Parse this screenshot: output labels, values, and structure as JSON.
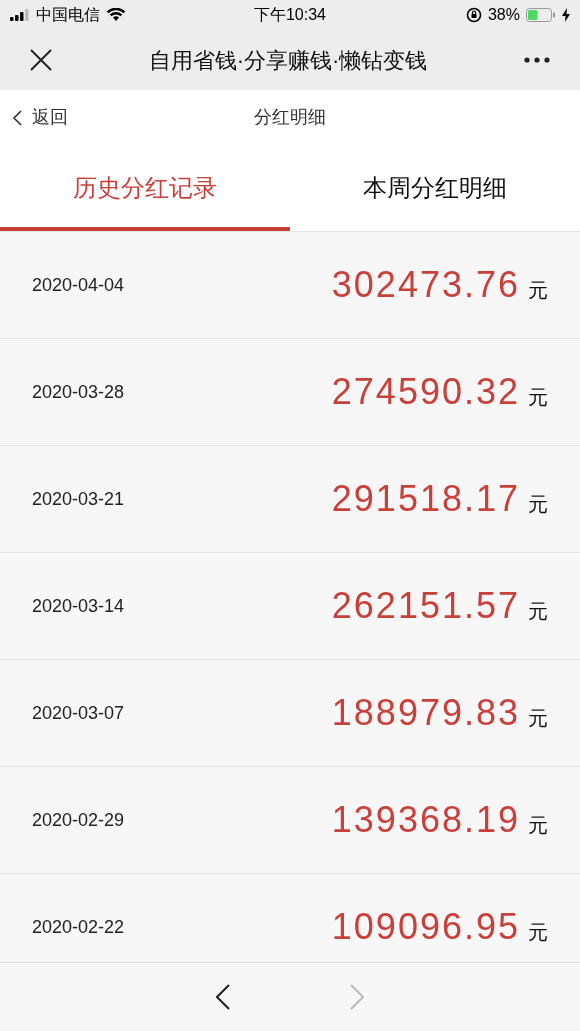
{
  "status_bar": {
    "carrier": "中国电信",
    "time": "下午10:34",
    "battery": "38%"
  },
  "window": {
    "title": "自用省钱·分享赚钱·懒钻变钱"
  },
  "header": {
    "back": "返回",
    "title": "分红明细"
  },
  "tabs": [
    {
      "label": "历史分红记录",
      "selected": true
    },
    {
      "label": "本周分红明细",
      "selected": false
    }
  ],
  "records": [
    {
      "date": "2020-04-04",
      "amount": "302473.76",
      "unit": "元"
    },
    {
      "date": "2020-03-28",
      "amount": "274590.32",
      "unit": "元"
    },
    {
      "date": "2020-03-21",
      "amount": "291518.17",
      "unit": "元"
    },
    {
      "date": "2020-03-14",
      "amount": "262151.57",
      "unit": "元"
    },
    {
      "date": "2020-03-07",
      "amount": "188979.83",
      "unit": "元"
    },
    {
      "date": "2020-02-29",
      "amount": "139368.19",
      "unit": "元"
    },
    {
      "date": "2020-02-22",
      "amount": "109096.95",
      "unit": "元"
    }
  ],
  "toolbar": {
    "back_disabled": false,
    "forward_disabled": true
  }
}
